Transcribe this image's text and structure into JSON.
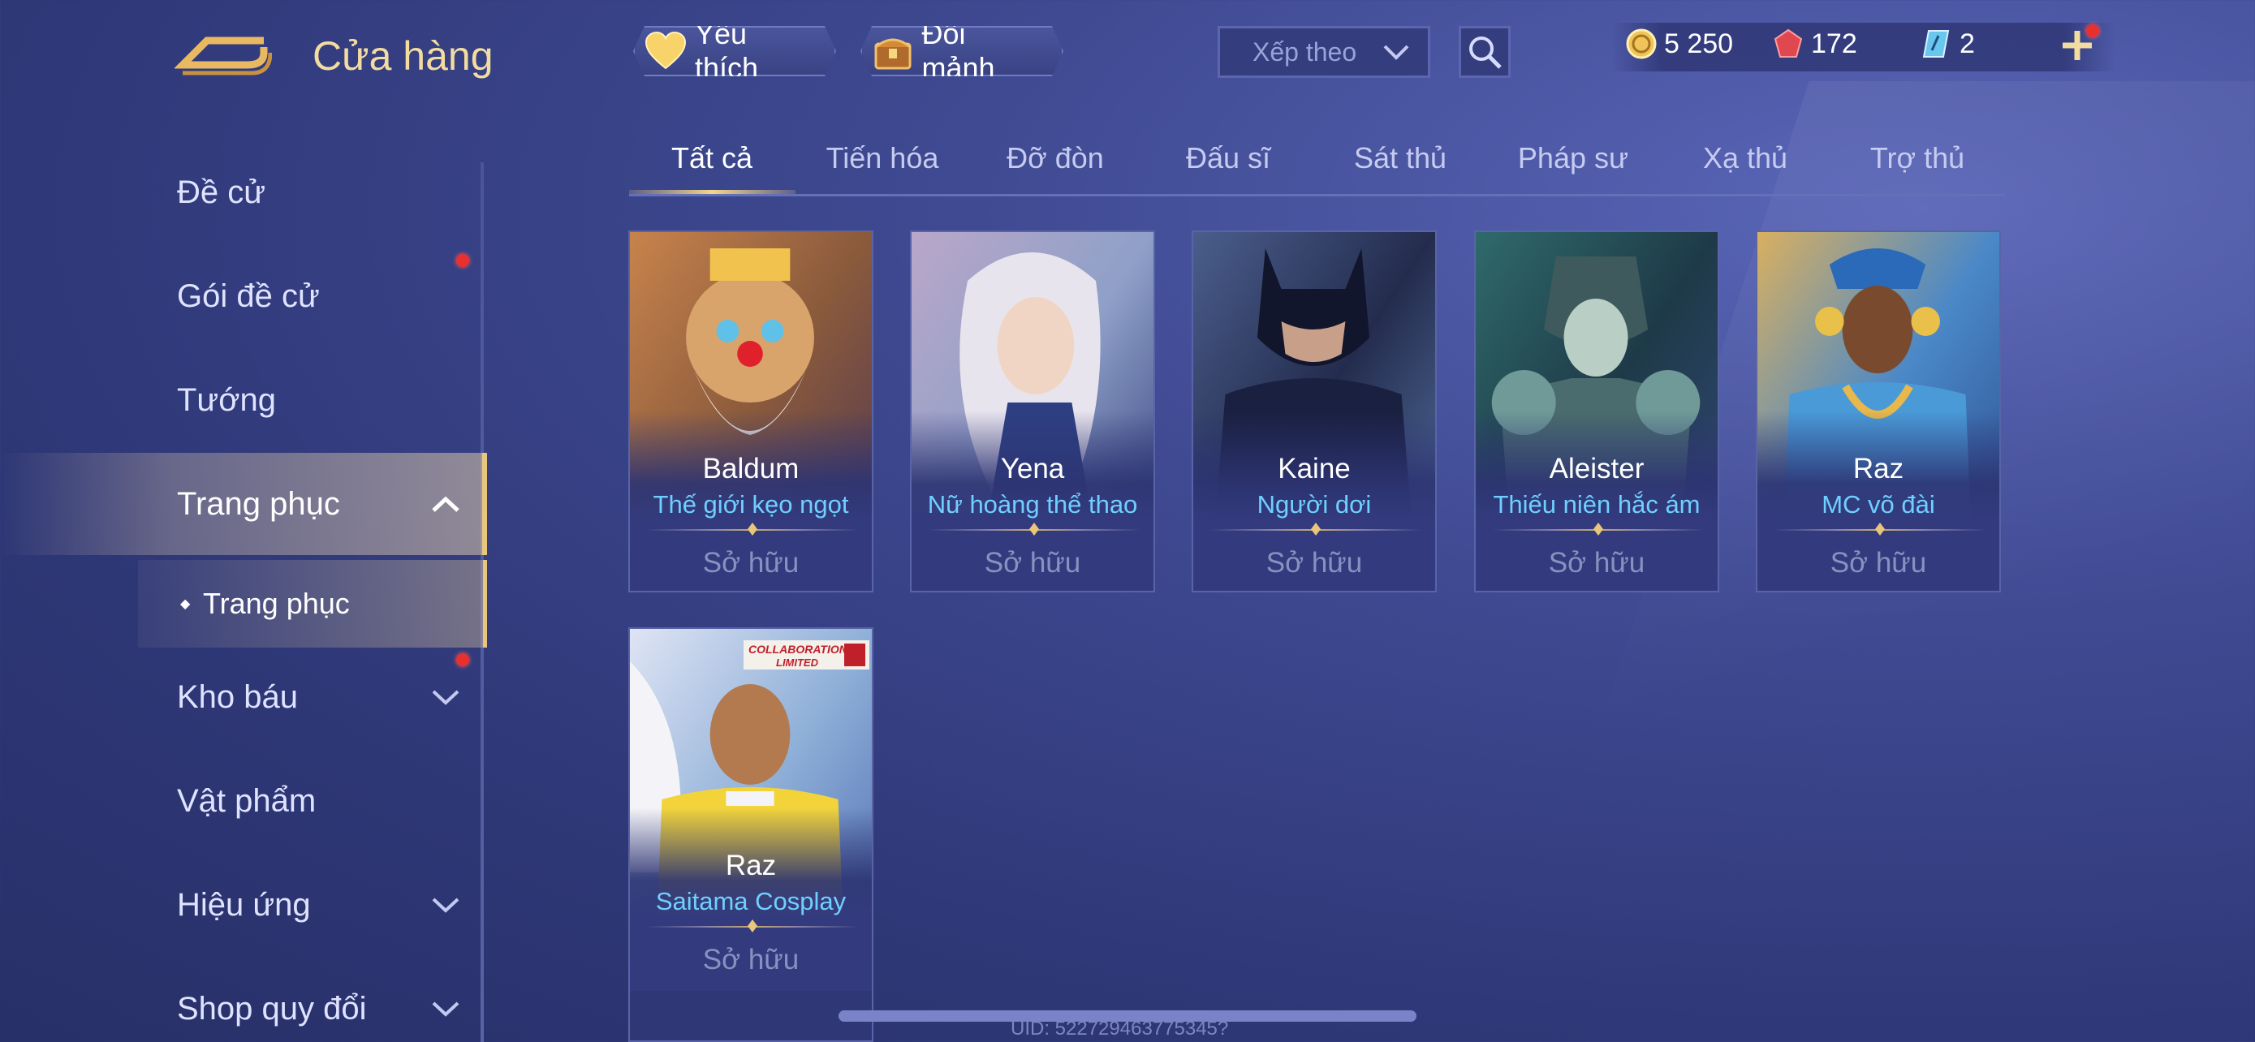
{
  "header": {
    "title": "Cửa hàng",
    "favorites_label": "Yêu thích",
    "exchange_label": "Đổi mảnh",
    "sort_placeholder": "Xếp theo",
    "currencies": {
      "gold": "5 250",
      "ruby": "172",
      "voucher": "2"
    }
  },
  "sidebar": {
    "items": [
      {
        "label": "Đề cử"
      },
      {
        "label": "Gói đề cử"
      },
      {
        "label": "Tướng"
      },
      {
        "label": "Trang phục"
      },
      {
        "label": "Kho báu"
      },
      {
        "label": "Vật phẩm"
      },
      {
        "label": "Hiệu ứng"
      },
      {
        "label": "Shop quy đổi"
      }
    ],
    "sub_item": "Trang phục"
  },
  "tabs": [
    "Tất cả",
    "Tiến hóa",
    "Đỡ đòn",
    "Đấu sĩ",
    "Sát thủ",
    "Pháp sư",
    "Xạ thủ",
    "Trợ thủ"
  ],
  "cards": [
    {
      "hero": "Baldum",
      "skin": "Thế giới kẹo ngọt",
      "status": "Sở hữu"
    },
    {
      "hero": "Yena",
      "skin": "Nữ hoàng thể thao",
      "status": "Sở hữu"
    },
    {
      "hero": "Kaine",
      "skin": "Người dơi",
      "status": "Sở hữu"
    },
    {
      "hero": "Aleister",
      "skin": "Thiếu niên hắc ám",
      "status": "Sở hữu"
    },
    {
      "hero": "Raz",
      "skin": "MC võ đài",
      "status": "Sở hữu"
    },
    {
      "hero": "Raz",
      "skin": "Saitama Cosplay",
      "status": "Sở hữu",
      "badge": "COLLABORATION LIMITED"
    }
  ],
  "footer": {
    "uid": "UID: 522729463775345?"
  },
  "colors": {
    "accent_gold": "#f3dca0",
    "skin_name": "#6fd0ff",
    "notification": "#e8302f"
  }
}
